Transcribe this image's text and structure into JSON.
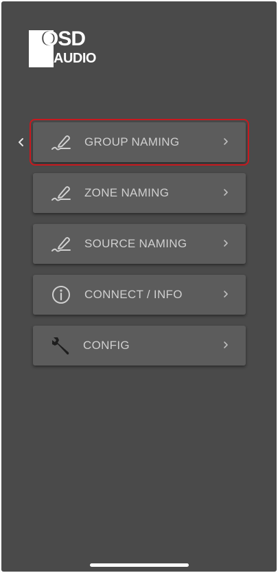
{
  "brand": {
    "logo_line1": "OSD",
    "logo_line2": "AUDIO"
  },
  "navigation": {
    "back_icon": "chevron-left-icon"
  },
  "menu": {
    "items": [
      {
        "label": "GROUP NAMING",
        "icon": "pencil-icon",
        "selected": true
      },
      {
        "label": "ZONE NAMING",
        "icon": "pencil-icon",
        "selected": false
      },
      {
        "label": "SOURCE NAMING",
        "icon": "pencil-icon",
        "selected": false
      },
      {
        "label": "CONNECT / INFO",
        "icon": "info-icon",
        "selected": false
      },
      {
        "label": "CONFIG",
        "icon": "wrench-icon",
        "selected": false
      }
    ]
  },
  "colors": {
    "background": "#4a4a4a",
    "button": "#5c5c5c",
    "text": "#cfcfcf",
    "selection_outline": "#c8191e"
  }
}
